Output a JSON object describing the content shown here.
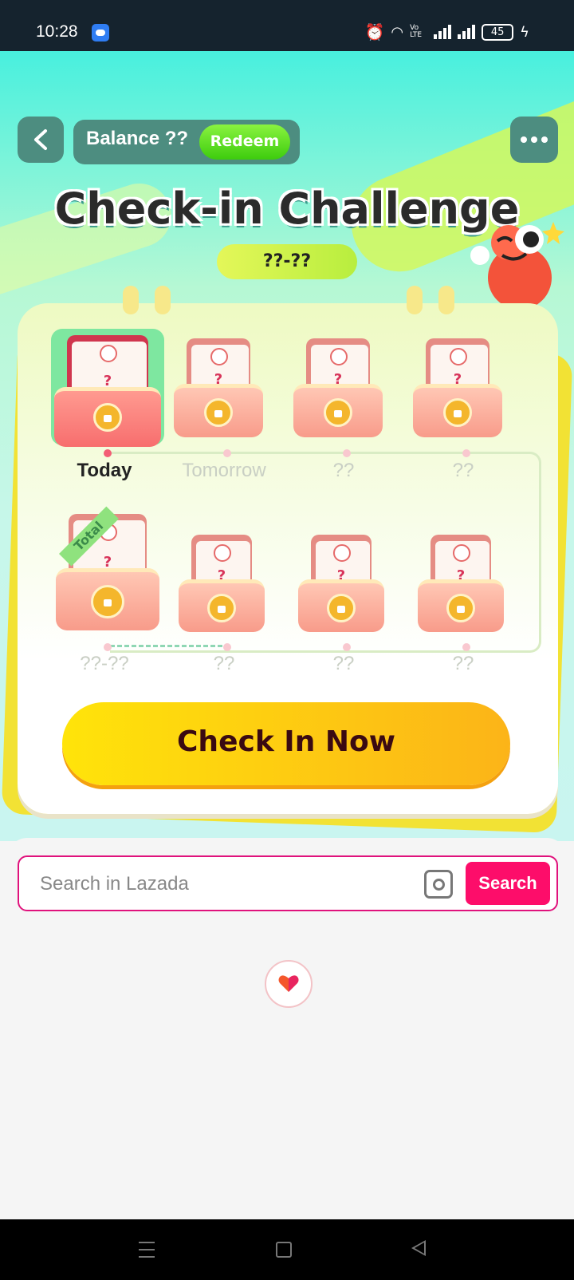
{
  "status_bar": {
    "time": "10:28",
    "battery": "45",
    "volte": "Vo LTE"
  },
  "header": {
    "balance_label": "Balance ??",
    "redeem_label": "Redeem"
  },
  "challenge": {
    "title": "Check-in Challenge",
    "date_range": "??-??",
    "row1": [
      {
        "label": "Today",
        "state": "active"
      },
      {
        "label": "Tomorrow",
        "state": "locked"
      },
      {
        "label": "??",
        "state": "locked"
      },
      {
        "label": "??",
        "state": "locked"
      }
    ],
    "row2": [
      {
        "label": "??-??",
        "state": "locked",
        "ribbon": "Total"
      },
      {
        "label": "??",
        "state": "locked"
      },
      {
        "label": "??",
        "state": "locked"
      },
      {
        "label": "??",
        "state": "locked"
      }
    ],
    "envelope_mark": "?",
    "check_in_label": "Check In Now"
  },
  "search": {
    "placeholder": "Search in Lazada",
    "button_label": "Search"
  },
  "colors": {
    "accent": "#fd0d6a",
    "teal": "#4d8d80",
    "yellow": "#ffe40a"
  }
}
